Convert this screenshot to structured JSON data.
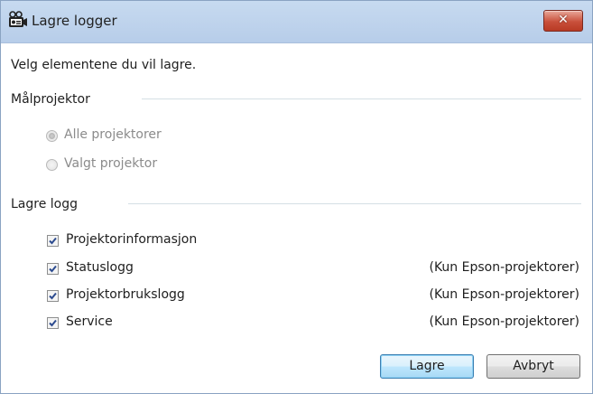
{
  "window": {
    "title": "Lagre logger",
    "close_label": "✕"
  },
  "intro": "Velg elementene du vil lagre.",
  "target_group": {
    "label": "Målprojektor",
    "options": [
      {
        "label": "Alle projektorer",
        "selected": true
      },
      {
        "label": "Valgt projektor",
        "selected": false
      }
    ]
  },
  "log_group": {
    "label": "Lagre logg",
    "items": [
      {
        "label": "Projektorinformasjon",
        "note": "",
        "checked": true
      },
      {
        "label": "Statuslogg",
        "note": "(Kun Epson-projektorer)",
        "checked": true
      },
      {
        "label": "Projektorbrukslogg",
        "note": "(Kun Epson-projektorer)",
        "checked": true
      },
      {
        "label": "Service",
        "note": "(Kun Epson-projektorer)",
        "checked": true
      }
    ]
  },
  "buttons": {
    "save": "Lagre",
    "cancel": "Avbryt"
  },
  "icons": {
    "title": "projector-camera-icon",
    "close": "close-icon",
    "check": "checkmark-icon"
  },
  "colors": {
    "titlebar": "#c3d6ee",
    "close": "#c9503b",
    "default_button": "#bee6fd"
  }
}
